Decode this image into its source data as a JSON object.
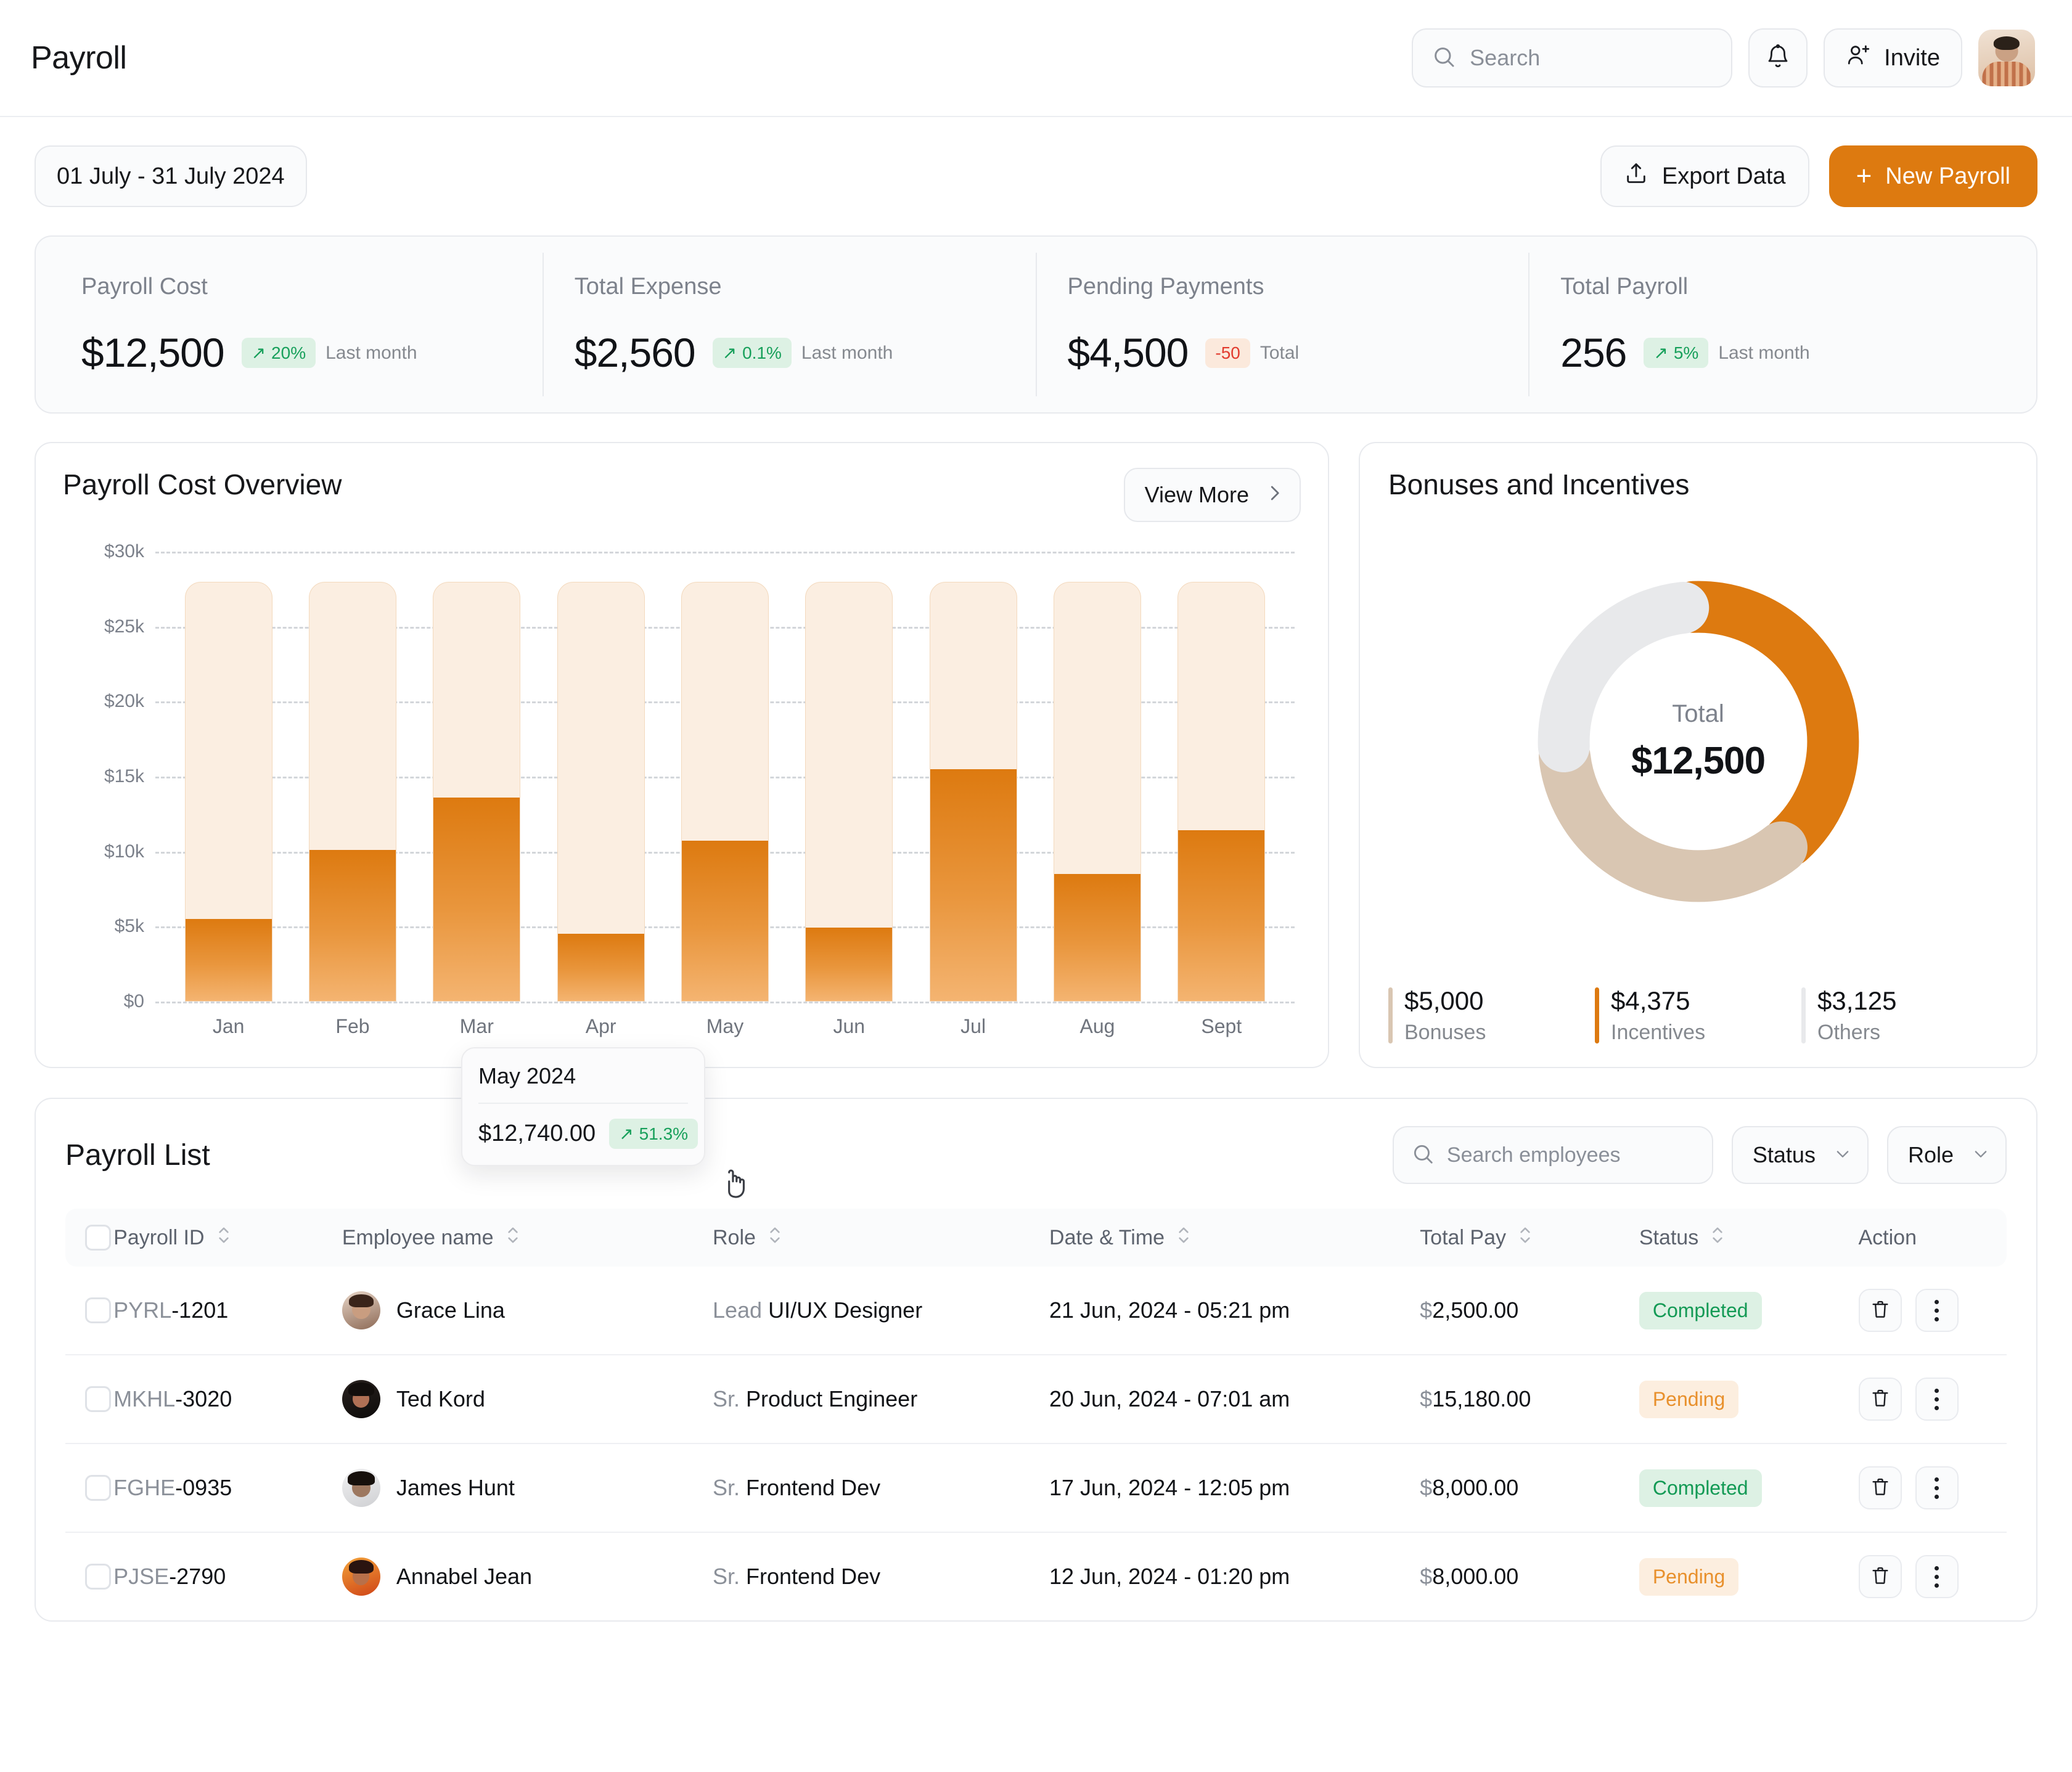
{
  "header": {
    "page_title": "Payroll",
    "search": {
      "placeholder": "Search",
      "icon": "search-icon"
    },
    "notification_icon": "bell-icon",
    "invite_label": "Invite",
    "invite_icon": "user-plus-icon",
    "avatar": "user-avatar"
  },
  "toolbar": {
    "date_range": "01 July - 31 July 2024",
    "export_label": "Export Data",
    "export_icon": "upload-icon",
    "new_payroll_label": "New Payroll",
    "new_payroll_icon": "plus-icon",
    "accent_color": "#dd7a10"
  },
  "kpis": [
    {
      "label": "Payroll Cost",
      "value": "$12,500",
      "delta": "20%",
      "direction": "up",
      "sub": "Last month"
    },
    {
      "label": "Total Expense",
      "value": "$2,560",
      "delta": "0.1%",
      "direction": "up",
      "sub": "Last month"
    },
    {
      "label": "Pending Payments",
      "value": "$4,500",
      "delta": "-50",
      "direction": "down",
      "sub": "Total"
    },
    {
      "label": "Total Payroll",
      "value": "256",
      "delta": "5%",
      "direction": "up",
      "sub": "Last month"
    }
  ],
  "chart_card": {
    "title": "Payroll Cost Overview",
    "view_more_label": "View More",
    "chevron_icon": "chevron-right-icon",
    "tooltip": {
      "title": "May 2024",
      "value": "$12,740.00",
      "delta": "51.3%",
      "direction": "up"
    }
  },
  "chart_data": {
    "type": "bar",
    "title": "Payroll Cost Overview",
    "categories": [
      "Jan",
      "Feb",
      "Mar",
      "Apr",
      "May",
      "Jun",
      "Jul",
      "Aug",
      "Sept"
    ],
    "values": [
      5500,
      10100,
      13600,
      4500,
      10700,
      4900,
      15500,
      8500,
      11400
    ],
    "track_max": 28000,
    "xlabel": "",
    "ylabel": "",
    "ylim": [
      0,
      30000
    ],
    "ytick_values": [
      0,
      5000,
      10000,
      15000,
      20000,
      25000,
      30000
    ],
    "ytick_labels": [
      "$0",
      "$5k",
      "$10k",
      "$15k",
      "$20k",
      "$25k",
      "$30k"
    ],
    "grid": true,
    "grid_style": "dashed-horizontal",
    "bar_color": "#dd7a10",
    "bar_track_color": "#fbeee1",
    "legend": "none"
  },
  "donut_card": {
    "title": "Bonuses and Incentives",
    "center_label": "Total",
    "center_value": "$12,500"
  },
  "donut_data": {
    "type": "pie",
    "title": "Bonuses and Incentives",
    "labels": [
      "Bonuses",
      "Incentives",
      "Others"
    ],
    "values": [
      5000,
      4375,
      3125
    ],
    "value_labels": [
      "$5,000",
      "$4,375",
      "$3,125"
    ],
    "percentages": [
      40,
      35,
      25
    ],
    "colors": [
      "#d9c6b2",
      "#dd7a10",
      "#e8e9eb"
    ],
    "segment_colors_ordered": [
      "#dd7a10",
      "#d9c6b2",
      "#e8e9eb"
    ],
    "total": 12500,
    "legend": "bottom"
  },
  "table": {
    "title": "Payroll List",
    "search": {
      "placeholder": "Search employees",
      "icon": "search-icon"
    },
    "filters": [
      {
        "label": "Status",
        "icon": "chevron-down-icon"
      },
      {
        "label": "Role",
        "icon": "chevron-down-icon"
      }
    ],
    "columns": [
      {
        "label": "Payroll ID",
        "sortable": true
      },
      {
        "label": "Employee name",
        "sortable": true
      },
      {
        "label": "Role",
        "sortable": true
      },
      {
        "label": "Date & Time",
        "sortable": true
      },
      {
        "label": "Total Pay",
        "sortable": true
      },
      {
        "label": "Status",
        "sortable": true
      },
      {
        "label": "Action",
        "sortable": false
      }
    ],
    "rows": [
      {
        "id_prefix": "PYRL",
        "id_suffix": "-1201",
        "name": "Grace Lina",
        "avatar": "av1",
        "role_prefix": "Lead",
        "role_main": "UI/UX Designer",
        "datetime": "21 Jun, 2024 - 05:21 pm",
        "pay_currency": "$",
        "pay_amount": "2,500.00",
        "status": "Completed",
        "status_kind": "completed"
      },
      {
        "id_prefix": "MKHL",
        "id_suffix": "-3020",
        "name": "Ted Kord",
        "avatar": "av2",
        "role_prefix": "Sr.",
        "role_main": "Product Engineer",
        "datetime": "20 Jun, 2024 - 07:01 am",
        "pay_currency": "$",
        "pay_amount": "15,180.00",
        "status": "Pending",
        "status_kind": "pending"
      },
      {
        "id_prefix": "FGHE",
        "id_suffix": "-0935",
        "name": "James Hunt",
        "avatar": "av3",
        "role_prefix": "Sr.",
        "role_main": "Frontend Dev",
        "datetime": "17 Jun, 2024 - 12:05 pm",
        "pay_currency": "$",
        "pay_amount": "8,000.00",
        "status": "Completed",
        "status_kind": "completed"
      },
      {
        "id_prefix": "PJSE",
        "id_suffix": "-2790",
        "name": "Annabel Jean",
        "avatar": "av4",
        "role_prefix": "Sr.",
        "role_main": "Frontend Dev",
        "datetime": "12 Jun, 2024 - 01:20 pm",
        "pay_currency": "$",
        "pay_amount": "8,000.00",
        "status": "Pending",
        "status_kind": "pending"
      }
    ],
    "row_actions": {
      "delete_icon": "trash-icon",
      "more_icon": "kebab-menu-icon"
    }
  }
}
